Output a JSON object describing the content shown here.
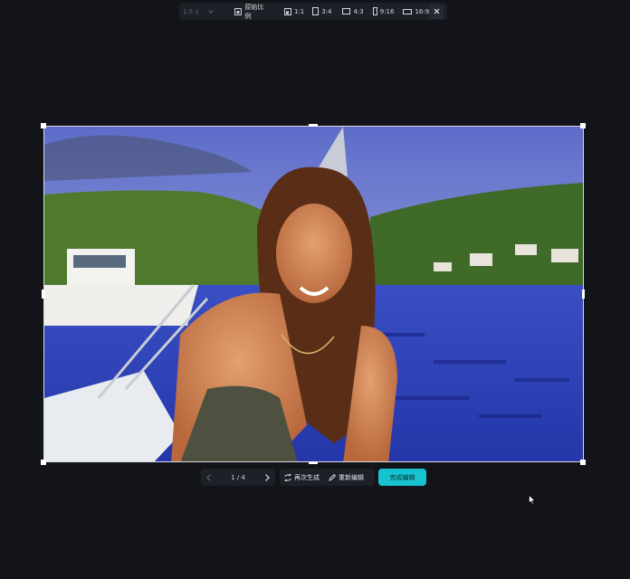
{
  "toolbar": {
    "scale": "1.5 x",
    "original_ratio": "原始比例",
    "ratios": [
      {
        "label": "1:1"
      },
      {
        "label": "3:4"
      },
      {
        "label": "4:3"
      },
      {
        "label": "9:16"
      },
      {
        "label": "16:9"
      }
    ]
  },
  "pager": {
    "page": "1 / 4"
  },
  "actions": {
    "regenerate": "再次生成",
    "reedit": "重新编辑",
    "finish": "完成编辑"
  },
  "colors": {
    "background": "#121419",
    "panel": "#1e2027",
    "accent": "#17c3cf"
  }
}
